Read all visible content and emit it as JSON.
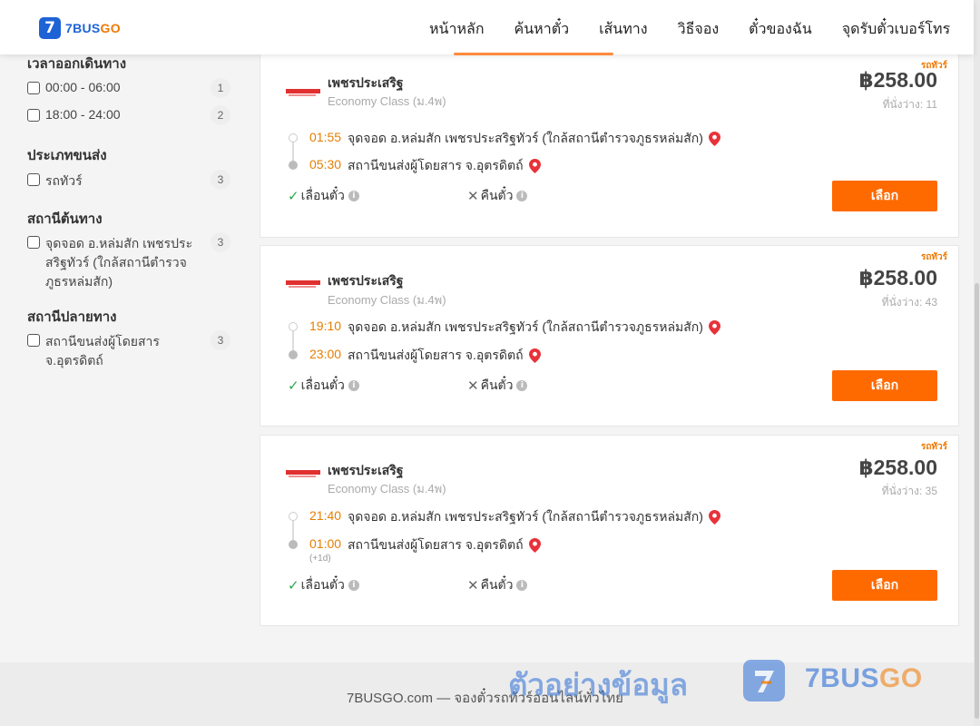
{
  "header": {
    "logo_text_a": "7BUS",
    "logo_text_b": "GO",
    "logo_mark": "7",
    "nav": [
      "หน้าหลัก",
      "ค้นหาตั๋ว",
      "เส้นทาง",
      "วิธีจอง",
      "ตั๋วของฉัน",
      "จุดรับตั๋วเบอร์โทร"
    ]
  },
  "sidebar": {
    "departure_time": {
      "title": "เวลาออกเดินทาง",
      "options": [
        {
          "label": "00:00 - 06:00",
          "count": "1"
        },
        {
          "label": "18:00 - 24:00",
          "count": "2"
        }
      ]
    },
    "transport_type": {
      "title": "ประเภทขนส่ง",
      "options": [
        {
          "label": "รถทัวร์",
          "count": "3"
        }
      ]
    },
    "origin": {
      "title": "สถานีต้นทาง",
      "options": [
        {
          "label": "จุดจอด อ.หล่มสัก เพชรประสริฐทัวร์ (ใกล้สถานีตำรวจภูธรหล่มสัก)",
          "count": "3"
        }
      ]
    },
    "destination": {
      "title": "สถานีปลายทาง",
      "options": [
        {
          "label": "สถานีขนส่งผู้โดยสาร จ.อุตรดิตถ์",
          "count": "3"
        }
      ]
    }
  },
  "results": [
    {
      "type_tag": "รถทัวร์",
      "operator": "เพชรประเสริฐ",
      "class": "Economy Class (ม.4พ)",
      "price": "฿258.00",
      "seats": "ที่นั่งว่าง: 11",
      "depart_time": "01:55",
      "depart_stop": "จุดจอด อ.หล่มสัก เพชรประสริฐทัวร์ (ใกล้สถานีตำรวจภูธรหล่มสัก)",
      "arrive_time": "05:30",
      "arrive_stop": "สถานีขนส่งผู้โดยสาร จ.อุตรดิตถ์",
      "next_day": "",
      "reschedule": "เลื่อนตั๋ว",
      "refund": "คืนตั๋ว",
      "select": "เลือก"
    },
    {
      "type_tag": "รถทัวร์",
      "operator": "เพชรประเสริฐ",
      "class": "Economy Class (ม.4พ)",
      "price": "฿258.00",
      "seats": "ที่นั่งว่าง: 43",
      "depart_time": "19:10",
      "depart_stop": "จุดจอด อ.หล่มสัก เพชรประสริฐทัวร์ (ใกล้สถานีตำรวจภูธรหล่มสัก)",
      "arrive_time": "23:00",
      "arrive_stop": "สถานีขนส่งผู้โดยสาร จ.อุตรดิตถ์",
      "next_day": "",
      "reschedule": "เลื่อนตั๋ว",
      "refund": "คืนตั๋ว",
      "select": "เลือก"
    },
    {
      "type_tag": "รถทัวร์",
      "operator": "เพชรประเสริฐ",
      "class": "Economy Class (ม.4พ)",
      "price": "฿258.00",
      "seats": "ที่นั่งว่าง: 35",
      "depart_time": "21:40",
      "depart_stop": "จุดจอด อ.หล่มสัก เพชรประสริฐทัวร์ (ใกล้สถานีตำรวจภูธรหล่มสัก)",
      "arrive_time": "01:00",
      "arrive_stop": "สถานีขนส่งผู้โดยสาร จ.อุตรดิตถ์",
      "next_day": "(+1d)",
      "reschedule": "เลื่อนตั๋ว",
      "refund": "คืนตั๋ว",
      "select": "เลือก"
    }
  ],
  "footer": {
    "text": "7BUSGO.com — จองตั๋วรถทัวร์ออนไลน์ทั่วไทย"
  },
  "watermark": {
    "text": "ตัวอย่างข้อมูล",
    "brand_a": "7BUS",
    "brand_b": "GO"
  },
  "colors": {
    "accent": "#ff6a00",
    "brand_blue": "#1e63d6",
    "time_orange": "#e67e00"
  }
}
